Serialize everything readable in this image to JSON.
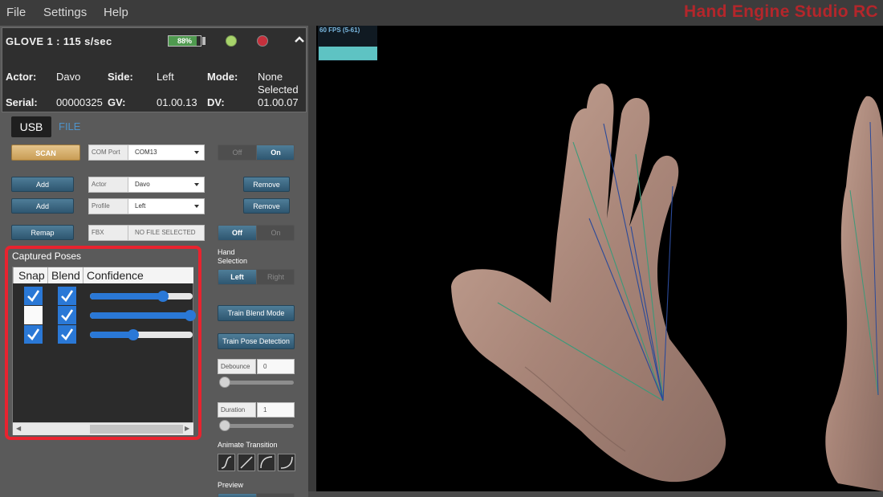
{
  "menu": {
    "file": "File",
    "settings": "Settings",
    "help": "Help"
  },
  "app_title": "Hand Engine Studio RC",
  "glove": {
    "title": "GLOVE 1 : 115 s/sec",
    "battery": "88%",
    "battery_level": 0.88,
    "actor_label": "Actor:",
    "actor_value": "Davo",
    "side_label": "Side:",
    "side_value": "Left",
    "mode_label": "Mode:",
    "mode_value_1": "None",
    "mode_value_2": "Selected",
    "serial_label": "Serial:",
    "serial_value": "00000325",
    "gv_label": "GV:",
    "gv_value": "01.00.13",
    "dv_label": "DV:",
    "dv_value": "01.00.07"
  },
  "tabs": {
    "usb": "USB",
    "file": "FILE"
  },
  "controls": {
    "scan": "SCAN",
    "com_port_label": "COM Port",
    "com_port_value": "COM13",
    "toggle1_off": "Off",
    "toggle1_on": "On",
    "add1": "Add",
    "actor_label": "Actor",
    "actor_value": "Davo",
    "remove1": "Remove",
    "add2": "Add",
    "profile_label": "Profile",
    "profile_value": "Left",
    "remove2": "Remove",
    "remap": "Remap",
    "fbx_label": "FBX",
    "fbx_value": "NO FILE SELECTED",
    "toggle2_off": "Off",
    "toggle2_on": "On"
  },
  "captured_poses": {
    "title": "Captured Poses",
    "columns": [
      "Snap",
      "Blend",
      "Confidence"
    ],
    "rows": [
      {
        "snap": true,
        "blend": true,
        "confidence": 0.71
      },
      {
        "snap": false,
        "blend": true,
        "confidence": 0.98
      },
      {
        "snap": true,
        "blend": true,
        "confidence": 0.42
      }
    ]
  },
  "right_controls": {
    "hand_selection": "Hand Selection",
    "left": "Left",
    "right": "Right",
    "train_blend": "Train Blend Mode",
    "train_pose": "Train Pose Detection",
    "debounce_label": "Debounce",
    "debounce_value": "0",
    "duration_label": "Duration",
    "duration_value": "1",
    "animate_transition": "Animate Transition",
    "preview": "Preview"
  },
  "viewport": {
    "fps": "60 FPS (5-61)"
  },
  "colors": {
    "accent_blue": "#2a78d6",
    "title_red": "#b4262b",
    "highlight_red": "#e8232f",
    "fps_bar": "#5ec3c3"
  }
}
